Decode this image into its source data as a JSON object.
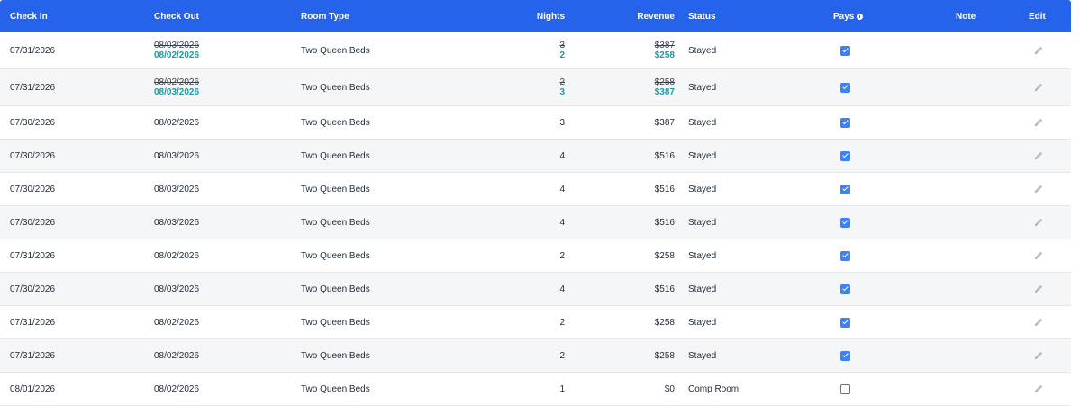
{
  "header": {
    "check_in": "Check In",
    "check_out": "Check Out",
    "room_type": "Room Type",
    "nights": "Nights",
    "revenue": "Revenue",
    "status": "Status",
    "pays": "Pays",
    "note": "Note",
    "edit": "Edit"
  },
  "colors": {
    "header_bg": "#2563eb",
    "changed_value": "#1a9ba7",
    "checkbox_checked": "#3b82f6"
  },
  "rows": [
    {
      "check_in": "07/31/2026",
      "check_out_old": "08/03/2026",
      "check_out": "08/02/2026",
      "room_type": "Two Queen Beds",
      "nights_old": "3",
      "nights": "2",
      "revenue_old": "$387",
      "revenue": "$258",
      "status": "Stayed",
      "pays": true,
      "note": ""
    },
    {
      "check_in": "07/31/2026",
      "check_out_old": "08/02/2026",
      "check_out": "08/03/2026",
      "room_type": "Two Queen Beds",
      "nights_old": "2",
      "nights": "3",
      "revenue_old": "$258",
      "revenue": "$387",
      "status": "Stayed",
      "pays": true,
      "note": ""
    },
    {
      "check_in": "07/30/2026",
      "check_out": "08/02/2026",
      "room_type": "Two Queen Beds",
      "nights": "3",
      "revenue": "$387",
      "status": "Stayed",
      "pays": true,
      "note": ""
    },
    {
      "check_in": "07/30/2026",
      "check_out": "08/03/2026",
      "room_type": "Two Queen Beds",
      "nights": "4",
      "revenue": "$516",
      "status": "Stayed",
      "pays": true,
      "note": ""
    },
    {
      "check_in": "07/30/2026",
      "check_out": "08/03/2026",
      "room_type": "Two Queen Beds",
      "nights": "4",
      "revenue": "$516",
      "status": "Stayed",
      "pays": true,
      "note": ""
    },
    {
      "check_in": "07/30/2026",
      "check_out": "08/03/2026",
      "room_type": "Two Queen Beds",
      "nights": "4",
      "revenue": "$516",
      "status": "Stayed",
      "pays": true,
      "note": ""
    },
    {
      "check_in": "07/31/2026",
      "check_out": "08/02/2026",
      "room_type": "Two Queen Beds",
      "nights": "2",
      "revenue": "$258",
      "status": "Stayed",
      "pays": true,
      "note": ""
    },
    {
      "check_in": "07/30/2026",
      "check_out": "08/03/2026",
      "room_type": "Two Queen Beds",
      "nights": "4",
      "revenue": "$516",
      "status": "Stayed",
      "pays": true,
      "note": ""
    },
    {
      "check_in": "07/31/2026",
      "check_out": "08/02/2026",
      "room_type": "Two Queen Beds",
      "nights": "2",
      "revenue": "$258",
      "status": "Stayed",
      "pays": true,
      "note": ""
    },
    {
      "check_in": "07/31/2026",
      "check_out": "08/02/2026",
      "room_type": "Two Queen Beds",
      "nights": "2",
      "revenue": "$258",
      "status": "Stayed",
      "pays": true,
      "note": ""
    },
    {
      "check_in": "08/01/2026",
      "check_out": "08/02/2026",
      "room_type": "Two Queen Beds",
      "nights": "1",
      "revenue": "$0",
      "status": "Comp Room",
      "pays": false,
      "note": ""
    }
  ]
}
